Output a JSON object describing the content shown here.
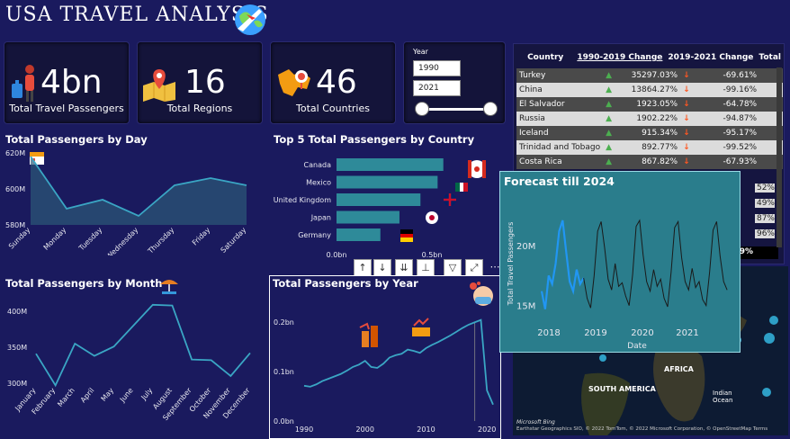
{
  "title": "USA TRAVEL ANALYSIS",
  "kpis": [
    {
      "value": "4bn",
      "label": "Total Travel Passengers",
      "icon": "traveler-icon"
    },
    {
      "value": "16",
      "label": "Total Regions",
      "icon": "map-pin-icon"
    },
    {
      "value": "46",
      "label": "Total Countries",
      "icon": "world-map-icon"
    }
  ],
  "year_slicer": {
    "label": "Year",
    "from": "1990",
    "to": "2021"
  },
  "table": {
    "headers": [
      "Country",
      "1990-2019 Change",
      "2019-2021 Change",
      "Total"
    ],
    "rows": [
      {
        "country": "Turkey",
        "c1": "35297.03%",
        "c2": "-69.61%"
      },
      {
        "country": "China",
        "c1": "13864.27%",
        "c2": "-99.16%"
      },
      {
        "country": "El Salvador",
        "c1": "1923.05%",
        "c2": "-64.78%"
      },
      {
        "country": "Russia",
        "c1": "1902.22%",
        "c2": "-94.87%"
      },
      {
        "country": "Iceland",
        "c1": "915.34%",
        "c2": "-95.17%"
      },
      {
        "country": "Trinidad and Tobago",
        "c1": "892.77%",
        "c2": "-99.52%"
      },
      {
        "country": "Costa Rica",
        "c1": "867.82%",
        "c2": "-67.93%"
      }
    ],
    "hidden_tail": [
      "52%",
      "49%",
      "87%",
      "96%",
      "89%"
    ],
    "total_prefix": "4."
  },
  "toolbar": [
    "↑",
    "↓",
    "⇊",
    "⊥",
    "▽",
    "⤢",
    "⋯"
  ],
  "map": {
    "labels": [
      "AFRICA",
      "SOUTH AMERICA",
      "Indian Ocean"
    ],
    "attribution": "Earthstar Geographics SIO, © 2022 TomTom, © 2022 Microsoft Corporation, © OpenStreetMap  Terms",
    "brand": "Microsoft Bing"
  },
  "chart_data": [
    {
      "type": "area",
      "title": "Total Passengers by Day",
      "categories": [
        "Sunday",
        "Monday",
        "Tuesday",
        "Wednesday",
        "Thursday",
        "Friday",
        "Saturday"
      ],
      "values": [
        618,
        589,
        594,
        585,
        602,
        606,
        602
      ],
      "yticks": [
        "620M",
        "600M",
        "580M"
      ],
      "ylim": [
        580,
        620
      ]
    },
    {
      "type": "bar",
      "title": "Top 5 Total Passengers by Country",
      "categories": [
        "Canada",
        "Mexico",
        "United Kingdom",
        "Japan",
        "Germany"
      ],
      "values": [
        0.56,
        0.53,
        0.44,
        0.33,
        0.23
      ],
      "xticks": [
        "0.0bn",
        "0.5bn"
      ],
      "xlim": [
        0,
        0.5
      ]
    },
    {
      "type": "line",
      "title": "Total Passengers by Month",
      "categories": [
        "January",
        "February",
        "March",
        "April",
        "May",
        "June",
        "July",
        "August",
        "September",
        "October",
        "November",
        "December"
      ],
      "values": [
        341,
        297,
        355,
        338,
        351,
        380,
        409,
        408,
        333,
        332,
        310,
        342
      ],
      "yticks": [
        "400M",
        "350M",
        "300M"
      ],
      "ylim": [
        300,
        400
      ]
    },
    {
      "type": "line",
      "title": "Total Passengers by Year",
      "x": [
        1990,
        1991,
        1992,
        1993,
        1994,
        1995,
        1996,
        1997,
        1998,
        1999,
        2000,
        2001,
        2002,
        2003,
        2004,
        2005,
        2006,
        2007,
        2008,
        2009,
        2010,
        2011,
        2012,
        2013,
        2014,
        2015,
        2016,
        2017,
        2018,
        2019,
        2020,
        2021
      ],
      "values": [
        0.075,
        0.073,
        0.078,
        0.085,
        0.09,
        0.095,
        0.1,
        0.107,
        0.115,
        0.12,
        0.128,
        0.115,
        0.113,
        0.122,
        0.135,
        0.14,
        0.143,
        0.152,
        0.149,
        0.145,
        0.155,
        0.162,
        0.168,
        0.175,
        0.182,
        0.19,
        0.198,
        0.205,
        0.21,
        0.215,
        0.065,
        0.035
      ],
      "yticks": [
        "0.2bn",
        "0.1bn",
        "0.0bn"
      ],
      "xticks": [
        "1990",
        "2000",
        "2010",
        "2020"
      ],
      "ylim": [
        0,
        0.2
      ]
    },
    {
      "type": "line",
      "title": "Forecast till 2024",
      "ylabel": "Total Travel Passengers",
      "xlabel": "Date",
      "yticks": [
        "20M",
        "15M"
      ],
      "xticks": [
        "2018",
        "2019",
        "2020",
        "2021"
      ],
      "actual": [
        16.2,
        14.7,
        17.5,
        16.8,
        18.5,
        21.2,
        22.1,
        19.5,
        17.0,
        16.2,
        18.0,
        16.8,
        17.3
      ],
      "forecast": [
        17.3,
        15.6,
        14.8,
        17.5,
        21.2,
        22.0,
        19.8,
        17.2,
        16.3,
        18.5,
        16.6,
        16.9,
        15.8,
        15.0,
        17.6,
        21.6,
        22.1,
        19.2,
        17.0,
        16.2,
        18.0,
        16.6,
        17.2,
        15.6,
        14.9,
        17.8,
        21.5,
        22.0,
        19.0,
        17.0,
        16.3,
        18.1,
        16.5,
        17.0,
        15.5,
        15.0,
        17.8,
        21.3,
        22.0,
        19.1,
        17.0,
        16.3
      ],
      "ylim": [
        14,
        23
      ]
    }
  ]
}
